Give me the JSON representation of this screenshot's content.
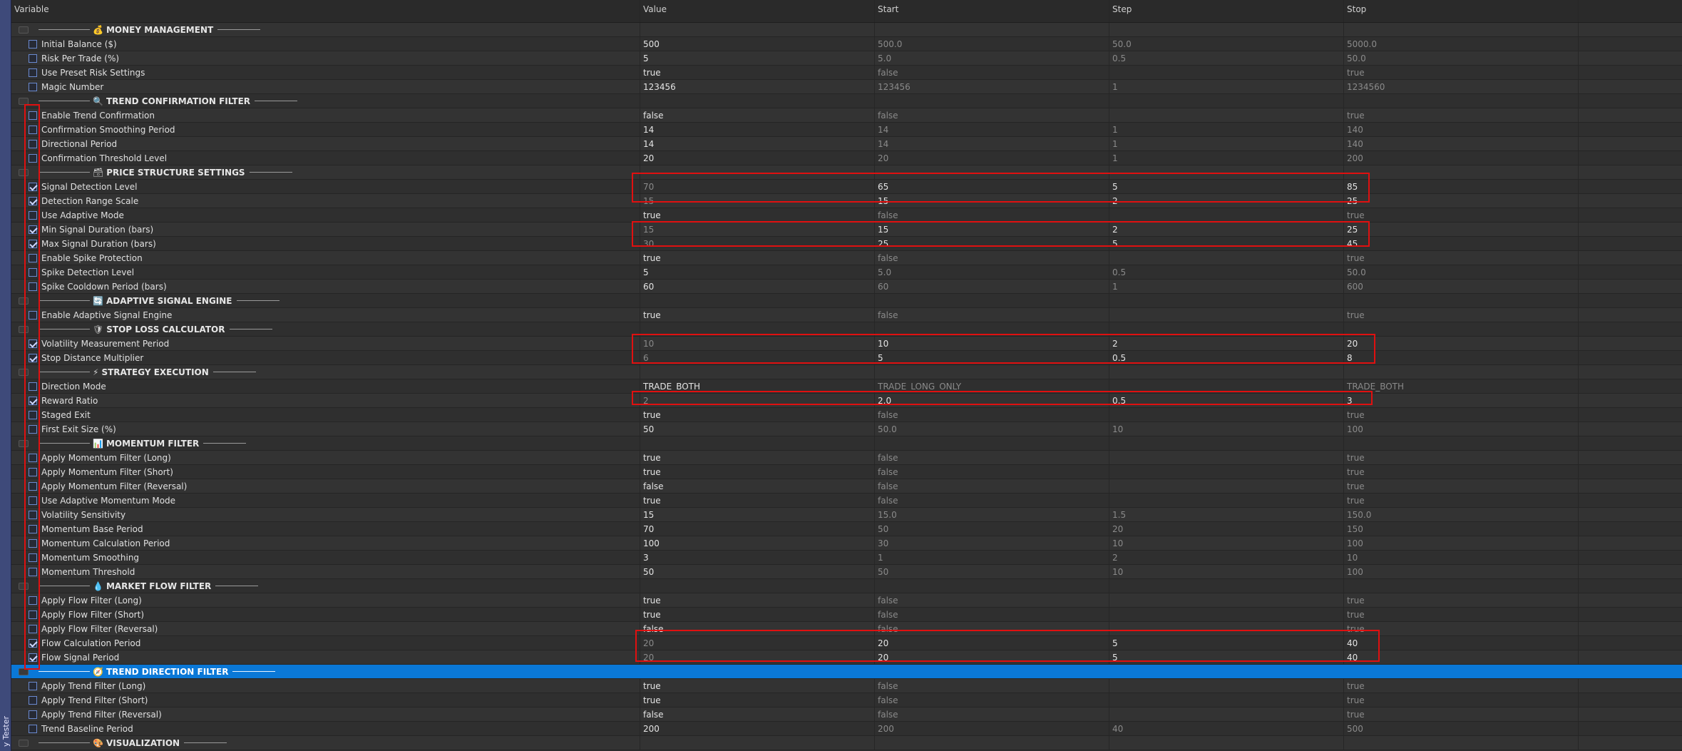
{
  "side_tab": "y Tester",
  "columns": {
    "variable": "Variable",
    "value": "Value",
    "start": "Start",
    "step": "Step",
    "stop": "Stop"
  },
  "rows": [
    {
      "type": "group",
      "icon": "💰",
      "label": "MONEY MANAGEMENT"
    },
    {
      "type": "param",
      "checked": false,
      "label": "Initial Balance ($)",
      "value": "500",
      "start": "500.0",
      "step": "50.0",
      "stop": "5000.0",
      "dimValue": false
    },
    {
      "type": "param",
      "checked": false,
      "label": "Risk Per Trade (%)",
      "value": "5",
      "start": "5.0",
      "step": "0.5",
      "stop": "50.0",
      "dimValue": false
    },
    {
      "type": "param",
      "checked": false,
      "label": "Use Preset Risk Settings",
      "value": "true",
      "start": "false",
      "step": "",
      "stop": "true",
      "dimValue": false
    },
    {
      "type": "param",
      "checked": false,
      "label": "Magic Number",
      "value": "123456",
      "start": "123456",
      "step": "1",
      "stop": "1234560",
      "dimValue": false
    },
    {
      "type": "group",
      "icon": "🔍",
      "label": "TREND CONFIRMATION FILTER"
    },
    {
      "type": "param",
      "checked": false,
      "label": "Enable Trend Confirmation",
      "value": "false",
      "start": "false",
      "step": "",
      "stop": "true",
      "dimValue": false
    },
    {
      "type": "param",
      "checked": false,
      "label": "Confirmation Smoothing Period",
      "value": "14",
      "start": "14",
      "step": "1",
      "stop": "140",
      "dimValue": false
    },
    {
      "type": "param",
      "checked": false,
      "label": "Directional Period",
      "value": "14",
      "start": "14",
      "step": "1",
      "stop": "140",
      "dimValue": false
    },
    {
      "type": "param",
      "checked": false,
      "label": "Confirmation Threshold Level",
      "value": "20",
      "start": "20",
      "step": "1",
      "stop": "200",
      "dimValue": false
    },
    {
      "type": "group",
      "icon": "🗃",
      "label": "PRICE STRUCTURE SETTINGS"
    },
    {
      "type": "param",
      "checked": true,
      "label": "Signal Detection Level",
      "value": "70",
      "start": "65",
      "step": "5",
      "stop": "85",
      "dimValue": true
    },
    {
      "type": "param",
      "checked": true,
      "label": "Detection Range Scale",
      "value": "15",
      "start": "15",
      "step": "2",
      "stop": "25",
      "dimValue": true
    },
    {
      "type": "param",
      "checked": false,
      "label": "Use Adaptive Mode",
      "value": "true",
      "start": "false",
      "step": "",
      "stop": "true",
      "dimValue": false
    },
    {
      "type": "param",
      "checked": true,
      "label": "Min Signal Duration (bars)",
      "value": "15",
      "start": "15",
      "step": "2",
      "stop": "25",
      "dimValue": true
    },
    {
      "type": "param",
      "checked": true,
      "label": "Max Signal Duration (bars)",
      "value": "30",
      "start": "25",
      "step": "5",
      "stop": "45",
      "dimValue": true
    },
    {
      "type": "param",
      "checked": false,
      "label": "Enable Spike Protection",
      "value": "true",
      "start": "false",
      "step": "",
      "stop": "true",
      "dimValue": false
    },
    {
      "type": "param",
      "checked": false,
      "label": "Spike Detection Level",
      "value": "5",
      "start": "5.0",
      "step": "0.5",
      "stop": "50.0",
      "dimValue": false
    },
    {
      "type": "param",
      "checked": false,
      "label": "Spike Cooldown Period (bars)",
      "value": "60",
      "start": "60",
      "step": "1",
      "stop": "600",
      "dimValue": false
    },
    {
      "type": "group",
      "icon": "🔄",
      "label": "ADAPTIVE SIGNAL ENGINE"
    },
    {
      "type": "param",
      "checked": false,
      "label": "Enable Adaptive Signal Engine",
      "value": "true",
      "start": "false",
      "step": "",
      "stop": "true",
      "dimValue": false
    },
    {
      "type": "group",
      "icon": "🛡",
      "label": "STOP LOSS CALCULATOR"
    },
    {
      "type": "param",
      "checked": true,
      "label": "Volatility Measurement Period",
      "value": "10",
      "start": "10",
      "step": "2",
      "stop": "20",
      "dimValue": true
    },
    {
      "type": "param",
      "checked": true,
      "label": "Stop Distance Multiplier",
      "value": "6",
      "start": "5",
      "step": "0.5",
      "stop": "8",
      "dimValue": true
    },
    {
      "type": "group",
      "icon": "⚡",
      "label": "STRATEGY EXECUTION"
    },
    {
      "type": "param",
      "checked": false,
      "label": "Direction Mode",
      "value": "TRADE_BOTH",
      "start": "TRADE_LONG_ONLY",
      "step": "",
      "stop": "TRADE_BOTH",
      "dimValue": false
    },
    {
      "type": "param",
      "checked": true,
      "label": "Reward Ratio",
      "value": "2",
      "start": "2.0",
      "step": "0.5",
      "stop": "3",
      "dimValue": true
    },
    {
      "type": "param",
      "checked": false,
      "label": "Staged Exit",
      "value": "true",
      "start": "false",
      "step": "",
      "stop": "true",
      "dimValue": false
    },
    {
      "type": "param",
      "checked": false,
      "label": "First Exit Size (%)",
      "value": "50",
      "start": "50.0",
      "step": "10",
      "stop": "100",
      "dimValue": false
    },
    {
      "type": "group",
      "icon": "📊",
      "label": "MOMENTUM FILTER"
    },
    {
      "type": "param",
      "checked": false,
      "label": "Apply Momentum Filter (Long)",
      "value": "true",
      "start": "false",
      "step": "",
      "stop": "true",
      "dimValue": false
    },
    {
      "type": "param",
      "checked": false,
      "label": "Apply Momentum Filter (Short)",
      "value": "true",
      "start": "false",
      "step": "",
      "stop": "true",
      "dimValue": false
    },
    {
      "type": "param",
      "checked": false,
      "label": "Apply Momentum Filter (Reversal)",
      "value": "false",
      "start": "false",
      "step": "",
      "stop": "true",
      "dimValue": false
    },
    {
      "type": "param",
      "checked": false,
      "label": "Use Adaptive Momentum Mode",
      "value": "true",
      "start": "false",
      "step": "",
      "stop": "true",
      "dimValue": false
    },
    {
      "type": "param",
      "checked": false,
      "label": "Volatility Sensitivity",
      "value": "15",
      "start": "15.0",
      "step": "1.5",
      "stop": "150.0",
      "dimValue": false
    },
    {
      "type": "param",
      "checked": false,
      "label": "Momentum Base Period",
      "value": "70",
      "start": "50",
      "step": "20",
      "stop": "150",
      "dimValue": false
    },
    {
      "type": "param",
      "checked": false,
      "label": "Momentum Calculation Period",
      "value": "100",
      "start": "30",
      "step": "10",
      "stop": "100",
      "dimValue": false
    },
    {
      "type": "param",
      "checked": false,
      "label": "Momentum Smoothing",
      "value": "3",
      "start": "1",
      "step": "2",
      "stop": "10",
      "dimValue": false
    },
    {
      "type": "param",
      "checked": false,
      "label": "Momentum Threshold",
      "value": "50",
      "start": "50",
      "step": "10",
      "stop": "100",
      "dimValue": false
    },
    {
      "type": "group",
      "icon": "💧",
      "label": "MARKET FLOW FILTER"
    },
    {
      "type": "param",
      "checked": false,
      "label": "Apply Flow Filter (Long)",
      "value": "true",
      "start": "false",
      "step": "",
      "stop": "true",
      "dimValue": false
    },
    {
      "type": "param",
      "checked": false,
      "label": "Apply Flow Filter (Short)",
      "value": "true",
      "start": "false",
      "step": "",
      "stop": "true",
      "dimValue": false
    },
    {
      "type": "param",
      "checked": false,
      "label": "Apply Flow Filter (Reversal)",
      "value": "false",
      "start": "false",
      "step": "",
      "stop": "true",
      "dimValue": false
    },
    {
      "type": "param",
      "checked": true,
      "label": "Flow Calculation Period",
      "value": "20",
      "start": "20",
      "step": "5",
      "stop": "40",
      "dimValue": true
    },
    {
      "type": "param",
      "checked": true,
      "label": "Flow Signal Period",
      "value": "20",
      "start": "20",
      "step": "5",
      "stop": "40",
      "dimValue": true
    },
    {
      "type": "group",
      "icon": "🧭",
      "label": "TREND DIRECTION FILTER",
      "selected": true
    },
    {
      "type": "param",
      "checked": false,
      "label": "Apply Trend Filter (Long)",
      "value": "true",
      "start": "false",
      "step": "",
      "stop": "true",
      "dimValue": false
    },
    {
      "type": "param",
      "checked": false,
      "label": "Apply Trend Filter (Short)",
      "value": "true",
      "start": "false",
      "step": "",
      "stop": "true",
      "dimValue": false
    },
    {
      "type": "param",
      "checked": false,
      "label": "Apply Trend Filter (Reversal)",
      "value": "false",
      "start": "false",
      "step": "",
      "stop": "true",
      "dimValue": false
    },
    {
      "type": "param",
      "checked": false,
      "label": "Trend Baseline Period",
      "value": "200",
      "start": "200",
      "step": "40",
      "stop": "500",
      "dimValue": false
    },
    {
      "type": "group",
      "icon": "🎨",
      "label": "VISUALIZATION"
    }
  ],
  "colors": {
    "highlight": "#e01010",
    "selected": "#0a78d7"
  }
}
